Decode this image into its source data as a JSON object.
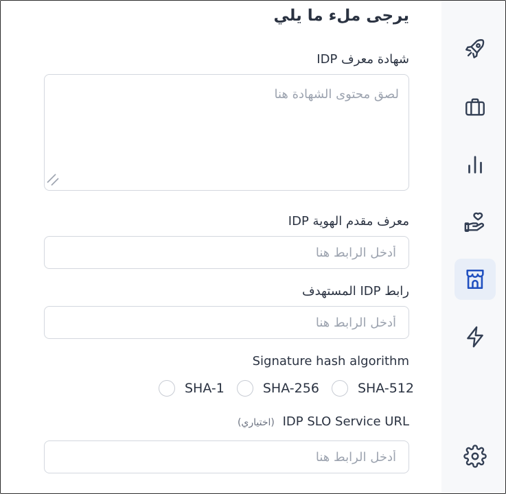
{
  "form": {
    "title": "يرجى ملء ما يلي",
    "certificate": {
      "label": "شهادة معرف IDP",
      "placeholder": "لصق محتوى الشهادة هنا"
    },
    "idp_id": {
      "label": "معرف مقدم الهوية IDP",
      "placeholder": "أدخل الرابط هنا"
    },
    "target_url": {
      "label": "رابط IDP المستهدف",
      "placeholder": "أدخل الرابط هنا"
    },
    "hash_algorithm": {
      "label": "Signature hash algorithm",
      "options": [
        "SHA-1",
        "SHA-256",
        "SHA-512"
      ]
    },
    "slo_url": {
      "label": "IDP SLO Service URL",
      "optional": "(اختياري)",
      "placeholder": "أدخل الرابط هنا"
    }
  },
  "sidebar": {
    "items": [
      {
        "icon": "rocket-icon"
      },
      {
        "icon": "briefcase-icon"
      },
      {
        "icon": "bar-chart-icon"
      },
      {
        "icon": "hand-heart-icon"
      },
      {
        "icon": "storefront-icon",
        "active": true
      },
      {
        "icon": "lightning-icon"
      },
      {
        "icon": "gear-icon"
      }
    ]
  },
  "colors": {
    "accent": "#1f4fbf",
    "active_bg": "#e8eef8",
    "text": "#2a3241",
    "sidebar_bg": "#f7f8fa"
  }
}
